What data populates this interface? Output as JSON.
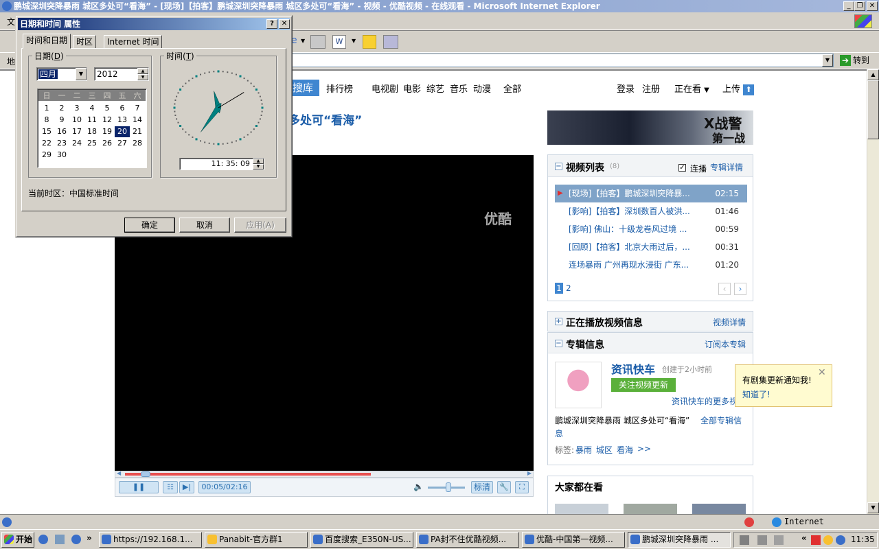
{
  "window": {
    "title": "鹏城深圳突降暴雨 城区多处可“看海” - [现场]【拍客】鹏城深圳突降暴雨 城区多处可“看海” - 视频 - 优酷视频 - 在线观看 - Microsoft Internet Explorer",
    "address_prefix": "地",
    "menu_first": "文",
    "go_label": "转到",
    "status_zone": "Internet"
  },
  "page": {
    "nav": [
      "搜库",
      "排行榜",
      "电视剧",
      "电影",
      "综艺",
      "音乐",
      "动漫",
      "全部"
    ],
    "login": "登录",
    "register": "注册",
    "watching": "正在看",
    "upload": "上传",
    "title": "多处可“看海”",
    "watermark": "优酷",
    "player": {
      "time": "00:05/02:16",
      "quality": "标清",
      "progress_fraction": 0.04
    },
    "banner": {
      "title": "X战警",
      "subtitle": "第一战"
    },
    "playlist": {
      "title": "视频列表",
      "count": "(8)",
      "autoplay": "连播",
      "detail_link": "专辑详情",
      "items": [
        {
          "title": "[现场]【拍客】鹏城深圳突降暴...",
          "duration": "02:15"
        },
        {
          "title": "[影响]【拍客】深圳数百人被洪...",
          "duration": "01:46"
        },
        {
          "title": "[影响] 佛山：十级龙卷风过境 ...",
          "duration": "00:59"
        },
        {
          "title": "[回顾]【拍客】北京大雨过后，...",
          "duration": "00:31"
        },
        {
          "title": "连场暴雨 广州再现水浸街 广东...",
          "duration": "01:20"
        }
      ],
      "pages": [
        "1",
        "2"
      ]
    },
    "now_playing": {
      "title": "正在播放视频信息",
      "link": "视频详情"
    },
    "album": {
      "title": "专辑信息",
      "subscribe": "订阅本专辑",
      "name": "资讯快车",
      "created": "创建于2小时前",
      "follow": "关注视频更新",
      "more": "资讯快车的更多视",
      "description": "鹏城深圳突降暴雨 城区多处可“看海”",
      "all_info": "全部专辑信",
      "all_info_2": "息",
      "tags_label": "标签:",
      "tags": [
        "暴雨",
        "城区",
        "看海"
      ],
      "tags_more": ">>"
    },
    "popup": {
      "text": "有剧集更新通知我!",
      "link": "知道了!"
    },
    "everyone_watching": "大家都在看"
  },
  "dialog": {
    "title": "日期和时间 属性",
    "tabs": [
      "时间和日期",
      "时区",
      "Internet 时间"
    ],
    "date_label": "日期",
    "date_hotkey": "D",
    "time_label": "时间",
    "time_hotkey": "T",
    "month": "四月",
    "year": "2012",
    "weekdays": [
      "日",
      "一",
      "二",
      "三",
      "四",
      "五",
      "六"
    ],
    "days": [
      "1",
      "2",
      "3",
      "4",
      "5",
      "6",
      "7",
      "8",
      "9",
      "10",
      "11",
      "12",
      "13",
      "14",
      "15",
      "16",
      "17",
      "18",
      "19",
      "20",
      "21",
      "22",
      "23",
      "24",
      "25",
      "26",
      "27",
      "28",
      "29",
      "30"
    ],
    "first_weekday_offset": 0,
    "selected_day": "20",
    "time": "11: 35: 09",
    "clock": {
      "hour": 11,
      "minute": 35,
      "second": 9
    },
    "timezone": "当前时区：中国标准时间",
    "ok": "确定",
    "cancel": "取消",
    "apply": "应用(A)"
  },
  "taskbar": {
    "start": "开始",
    "items": [
      "https://192.168.1...",
      "Panabit-官方群1",
      "百度搜索_E350N-US...",
      "PA封不住优酷视频...",
      "优酷-中国第一视频...",
      "鹏城深圳突降暴雨 ..."
    ],
    "clock": "11:35"
  }
}
